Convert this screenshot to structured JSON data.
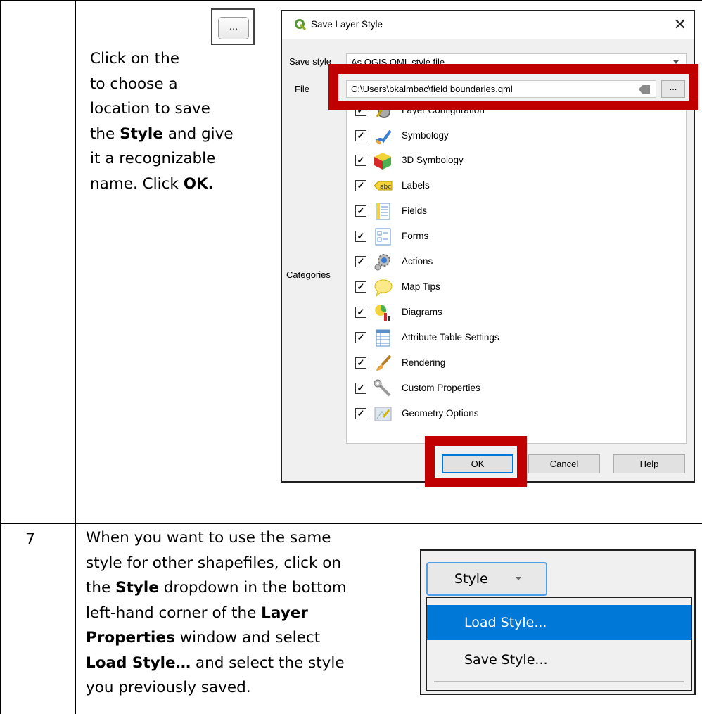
{
  "document": {
    "step6_text": {
      "l1": "Click on the",
      "l2": "to choose a",
      "l3": "location to save",
      "l4a": "the ",
      "l4b": "Style",
      "l4c": " and give",
      "l5": "it a recognizable",
      "l6a": "name.  Click ",
      "l6b": "OK."
    },
    "inline_button_label": "...",
    "step7_number": "7",
    "step7_text": {
      "l1": "When you want to use the same",
      "l2": "style for other shapefiles, click on",
      "l3a": "the ",
      "l3b": "Style",
      "l3c": " dropdown in the bottom",
      "l4a": "left-hand corner of the ",
      "l4b": "Layer",
      "l5a": "Properties",
      "l5b": " window and select",
      "l6a": "Load Style…",
      "l6b": " and select the style",
      "l7": "you previously saved."
    }
  },
  "dialog": {
    "title": "Save Layer Style",
    "save_style_label": "Save style",
    "save_style_value": "As QGIS QML style file",
    "file_label": "File",
    "file_value": "C:\\Users\\bkalmbac\\field boundaries.qml",
    "file_button": "...",
    "categories_label": "Categories",
    "categories": [
      {
        "label": "Layer Configuration",
        "icon": "layer-configuration-icon"
      },
      {
        "label": "Symbology",
        "icon": "symbology-brush-icon"
      },
      {
        "label": "3D Symbology",
        "icon": "3d-cube-icon"
      },
      {
        "label": "Labels",
        "icon": "labels-abc-icon"
      },
      {
        "label": "Fields",
        "icon": "fields-icon"
      },
      {
        "label": "Forms",
        "icon": "forms-icon"
      },
      {
        "label": "Actions",
        "icon": "actions-gear-icon"
      },
      {
        "label": "Map Tips",
        "icon": "map-tips-speech-icon"
      },
      {
        "label": "Diagrams",
        "icon": "diagrams-icon"
      },
      {
        "label": "Attribute Table Settings",
        "icon": "attribute-table-icon"
      },
      {
        "label": "Rendering",
        "icon": "rendering-brush-icon"
      },
      {
        "label": "Custom Properties",
        "icon": "custom-properties-wrench-icon"
      },
      {
        "label": "Geometry Options",
        "icon": "geometry-options-icon"
      }
    ],
    "ok_label": "OK",
    "cancel_label": "Cancel",
    "help_label": "Help",
    "highlight_color": "#c00000"
  },
  "style_menu": {
    "button_label": "Style",
    "items": [
      "Load Style...",
      "Save Style..."
    ],
    "selected_color": "#0078d7"
  }
}
